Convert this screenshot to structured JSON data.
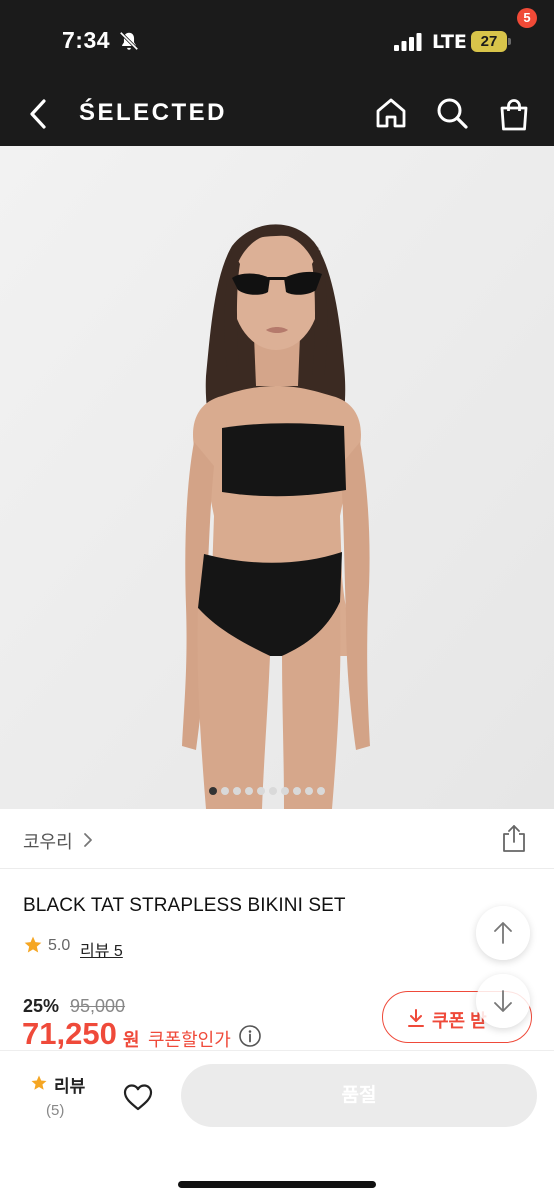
{
  "status_bar": {
    "time": "7:34",
    "network": "LTE",
    "battery_level": "27",
    "icons": [
      "bell-slash-icon",
      "signal-icon",
      "battery-icon"
    ]
  },
  "header": {
    "brand": "ŚELECTED",
    "cart_count": "5",
    "icons": [
      "back-icon",
      "home-icon",
      "search-icon",
      "cart-icon"
    ]
  },
  "gallery": {
    "total_images": 10,
    "active_index": 0
  },
  "brand_row": {
    "brand_name": "코우리"
  },
  "product": {
    "name": "BLACK TAT STRAPLESS BIKINI SET",
    "rating": "5.0",
    "review_link": "리뷰 5",
    "discount": "25%",
    "original_price": "95,000",
    "sale_price": "71,250",
    "currency": "원",
    "coupon_price_label": "쿠폰할인가",
    "coupon_button": "쿠폰 받"
  },
  "bottom_bar": {
    "review_label": "리뷰",
    "review_count": "(5)",
    "soldout_label": "품절"
  },
  "colors": {
    "header_bg": "#1b1b1b",
    "accent_red": "#ef4a3a",
    "star_yellow": "#f5a623",
    "image_bg": "#eeeeee",
    "soldout_bg": "#ebebeb"
  }
}
